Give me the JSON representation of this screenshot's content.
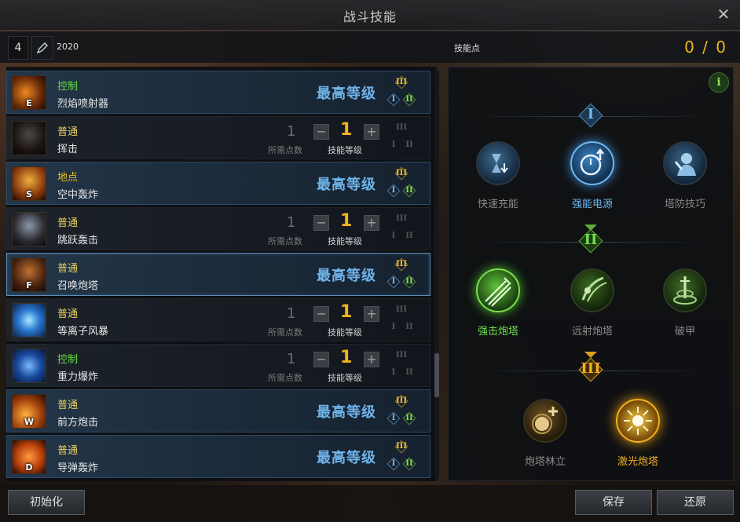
{
  "window": {
    "title": "战斗技能"
  },
  "topbar": {
    "level": "4",
    "skill_value": "2020",
    "skill_points_label": "技能点",
    "skill_points_value": "0 / 0"
  },
  "labels": {
    "max_level": "最高等级",
    "required_points": "所需点数",
    "skill_level": "技能等级"
  },
  "skills": [
    {
      "type": "控制",
      "name": "烈焰喷射器",
      "key": "E",
      "maxed": true,
      "current_level": "",
      "required_points": ""
    },
    {
      "type": "普通",
      "name": "挥击",
      "key": "",
      "maxed": false,
      "current_level": "1",
      "required_points": "1"
    },
    {
      "type": "地点",
      "name": "空中轰炸",
      "key": "S",
      "maxed": true,
      "current_level": "",
      "required_points": ""
    },
    {
      "type": "普通",
      "name": "跳跃轰击",
      "key": "",
      "maxed": false,
      "current_level": "1",
      "required_points": "1"
    },
    {
      "type": "普通",
      "name": "召唤炮塔",
      "key": "F",
      "maxed": true,
      "current_level": "",
      "required_points": ""
    },
    {
      "type": "普通",
      "name": "等离子风暴",
      "key": "",
      "maxed": false,
      "current_level": "1",
      "required_points": "1"
    },
    {
      "type": "控制",
      "name": "重力爆炸",
      "key": "",
      "maxed": false,
      "current_level": "1",
      "required_points": "1"
    },
    {
      "type": "普通",
      "name": "前方炮击",
      "key": "W",
      "maxed": true,
      "current_level": "",
      "required_points": ""
    },
    {
      "type": "普通",
      "name": "导弹轰炸",
      "key": "D",
      "maxed": true,
      "current_level": "",
      "required_points": ""
    }
  ],
  "tripod": {
    "tier1": {
      "label": "I",
      "options": [
        "快速充能",
        "强能电源",
        "塔防技巧"
      ]
    },
    "tier2": {
      "label": "II",
      "options": [
        "强击炮塔",
        "远射炮塔",
        "破甲"
      ]
    },
    "tier3": {
      "label": "III",
      "options": [
        "炮塔林立",
        "激光炮塔"
      ]
    }
  },
  "roman": {
    "one": "I",
    "two": "II",
    "three": "III"
  },
  "buttons": {
    "reset": "初始化",
    "save": "保存",
    "restore": "还原"
  },
  "colors": {
    "control": "#66dd44",
    "ground": "#e8c020",
    "normal": "#e8d060",
    "max_level": "#6fb4ea",
    "skill_points": "#e8b820"
  }
}
